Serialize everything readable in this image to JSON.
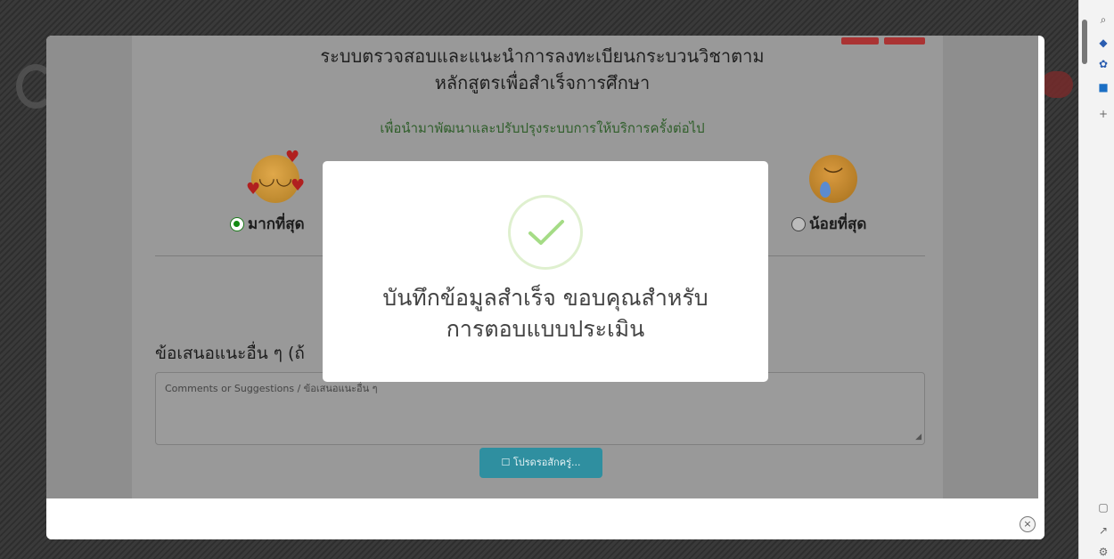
{
  "survey": {
    "title_line1": "ระบบตรวจสอบและแนะนำการลงทะเบียนกระบวนวิชาตาม",
    "title_line2": "หลักสูตรเพื่อสำเร็จการศึกษา",
    "subtitle": "เพื่อนำมาพัฒนาและปรับปรุงระบบการให้บริการครั้งต่อไป",
    "rating_most": "มากที่สุด",
    "rating_least": "น้อยที่สุด",
    "selected_rating": "มากที่สุด",
    "suggestion_label": "ข้อเสนอแนะอื่น ๆ (ถ้",
    "suggestion_placeholder": "Comments or Suggestions / ข้อเสนอแนะอื่น ๆ",
    "submit_label": "☐ โปรดรอสักครู่..."
  },
  "alert": {
    "message_line1": "บันทึกข้อมูลสำเร็จ ขอบคุณสำหรับ",
    "message_line2": "การตอบแบบประเมิน",
    "check_color": "#a5dc86"
  },
  "modal": {
    "close_glyph": "×"
  },
  "sidebar_icons": [
    "search-icon",
    "tag-icon",
    "settings-icon",
    "outlook-icon",
    "add-icon"
  ],
  "colors": {
    "success_green": "#a5dc86",
    "selected_radio": "#138a13",
    "submit_button": "#2f8fa0"
  }
}
